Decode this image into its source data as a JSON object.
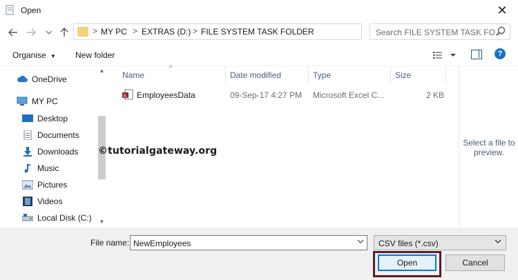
{
  "window": {
    "title": "Open"
  },
  "nav": {
    "back_icon": "back-arrow-icon",
    "forward_icon": "forward-arrow-icon",
    "recent_icon": "chevron-down-icon",
    "up_icon": "up-arrow-icon"
  },
  "address": {
    "crumbs": [
      "MY PC",
      "EXTRAS (D:)",
      "FILE SYSTEM TASK FOLDER"
    ],
    "separator": ">"
  },
  "search": {
    "placeholder": "Search FILE SYSTEM TASK FO..."
  },
  "toolbar": {
    "organise_label": "Organise",
    "new_folder_label": "New folder"
  },
  "sidebar": {
    "items": [
      {
        "label": "OneDrive",
        "icon": "cloud-icon"
      },
      {
        "label": "MY PC",
        "icon": "computer-icon"
      },
      {
        "label": "Desktop",
        "icon": "desktop-icon"
      },
      {
        "label": "Documents",
        "icon": "documents-icon"
      },
      {
        "label": "Downloads",
        "icon": "downloads-icon"
      },
      {
        "label": "Music",
        "icon": "music-icon"
      },
      {
        "label": "Pictures",
        "icon": "pictures-icon"
      },
      {
        "label": "Videos",
        "icon": "videos-icon"
      },
      {
        "label": "Local Disk (C:)",
        "icon": "drive-icon"
      }
    ]
  },
  "files": {
    "columns": [
      "Name",
      "Date modified",
      "Type",
      "Size"
    ],
    "rows": [
      {
        "name": "EmployeesData",
        "date": "09-Sep-17 4:27 PM",
        "type": "Microsoft Excel C...",
        "size": "2 KB",
        "icon": "excel-csv-icon"
      }
    ]
  },
  "preview": {
    "line1": "Select a file to",
    "line2": "preview."
  },
  "watermark": "©tutorialgateway.org",
  "footer": {
    "filename_label": "File name:",
    "filename_value": "NewEmployees",
    "filetype_value": "CSV files (*.csv)",
    "open_label": "Open",
    "cancel_label": "Cancel"
  },
  "colors": {
    "accent": "#0078d7",
    "highlight_frame": "#5a1b27",
    "folder": "#f2d27a",
    "header_text": "#4c607a"
  }
}
